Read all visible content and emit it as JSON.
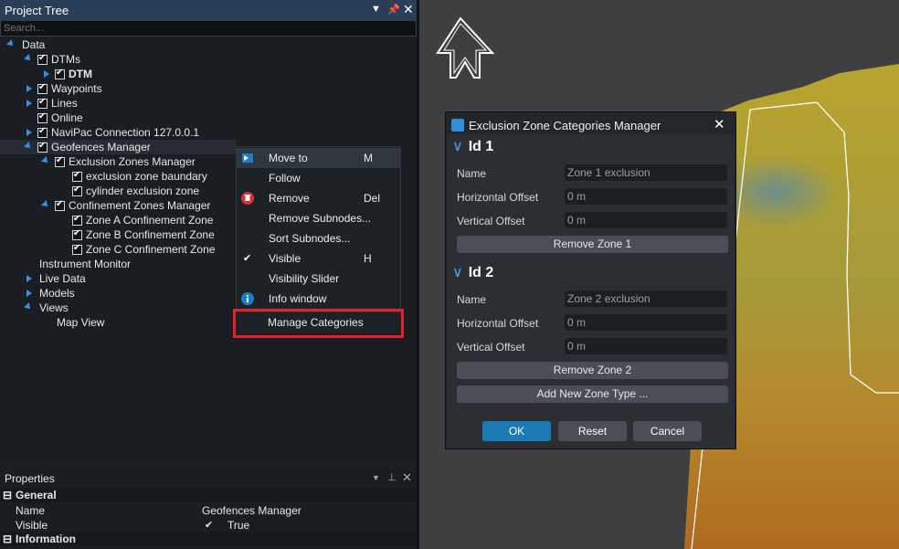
{
  "project_tree": {
    "title": "Project Tree",
    "search_placeholder": "Search...",
    "nodes": [
      {
        "label": "Data"
      },
      {
        "label": "DTMs"
      },
      {
        "label": "DTM"
      },
      {
        "label": "Waypoints"
      },
      {
        "label": "Lines"
      },
      {
        "label": "Online"
      },
      {
        "label": "NaviPac Connection 127.0.0.1"
      },
      {
        "label": "Geofences Manager"
      },
      {
        "label": "Exclusion Zones Manager"
      },
      {
        "label": "exclusion zone baundary"
      },
      {
        "label": "cylinder exclusion zone"
      },
      {
        "label": "Confinement Zones Manager"
      },
      {
        "label": "Zone A Confinement Zone"
      },
      {
        "label": "Zone B Confinement Zone"
      },
      {
        "label": "Zone C Confinement Zone"
      },
      {
        "label": "Instrument Monitor"
      },
      {
        "label": "Live Data"
      },
      {
        "label": "Models"
      },
      {
        "label": "Views"
      },
      {
        "label": "Map View"
      }
    ]
  },
  "context_menu": {
    "items": [
      {
        "label": "Move to",
        "shortcut": "M"
      },
      {
        "label": "Follow",
        "shortcut": ""
      },
      {
        "label": "Remove",
        "shortcut": "Del"
      },
      {
        "label": "Remove Subnodes...",
        "shortcut": ""
      },
      {
        "label": "Sort Subnodes...",
        "shortcut": ""
      },
      {
        "label": "Visible",
        "shortcut": "H"
      },
      {
        "label": "Visibility Slider",
        "shortcut": ""
      },
      {
        "label": "Info window",
        "shortcut": ""
      }
    ],
    "manage": "Manage Categories"
  },
  "properties": {
    "title": "Properties",
    "general": "General",
    "rows": [
      {
        "name": "Name",
        "value": "Geofences Manager"
      },
      {
        "name": "Visible",
        "value": "True"
      }
    ],
    "information": "Information"
  },
  "dialog": {
    "title": "Exclusion Zone Categories Manager",
    "zones": [
      {
        "id": "Id 1",
        "name": "Zone 1 exclusion",
        "h_offset": "0 m",
        "v_offset": "0 m",
        "remove": "Remove Zone 1"
      },
      {
        "id": "Id 2",
        "name": "Zone 2 exclusion",
        "h_offset": "0 m",
        "v_offset": "0 m",
        "remove": "Remove Zone 2"
      }
    ],
    "labels": {
      "name": "Name",
      "h_offset": "Horizontal Offset",
      "v_offset": "Vertical Offset"
    },
    "add_zone": "Add New Zone Type ...",
    "ok": "OK",
    "reset": "Reset",
    "cancel": "Cancel"
  },
  "colors": {
    "accent": "#2f8fd8",
    "ok_button": "#1a7ab4",
    "highlight_box": "#e0242b",
    "header": "#2a3e58"
  }
}
